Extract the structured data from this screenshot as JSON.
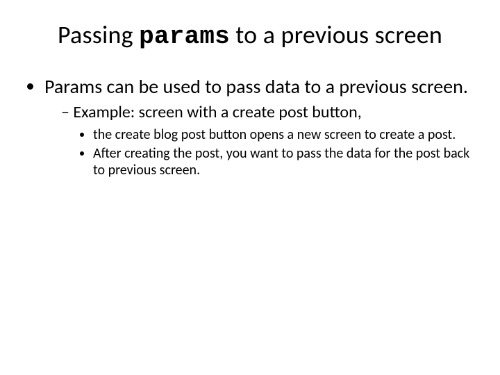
{
  "title": {
    "pre": "Passing ",
    "code": "params",
    "post": " to a previous screen"
  },
  "b1": "Params can be used to pass data to a previous screen.",
  "b2": "Example: screen with a create post button,",
  "b3": " the create blog post button opens a new screen to create a post.",
  "b4": "After creating the post, you want to pass the data for the post back to previous screen."
}
